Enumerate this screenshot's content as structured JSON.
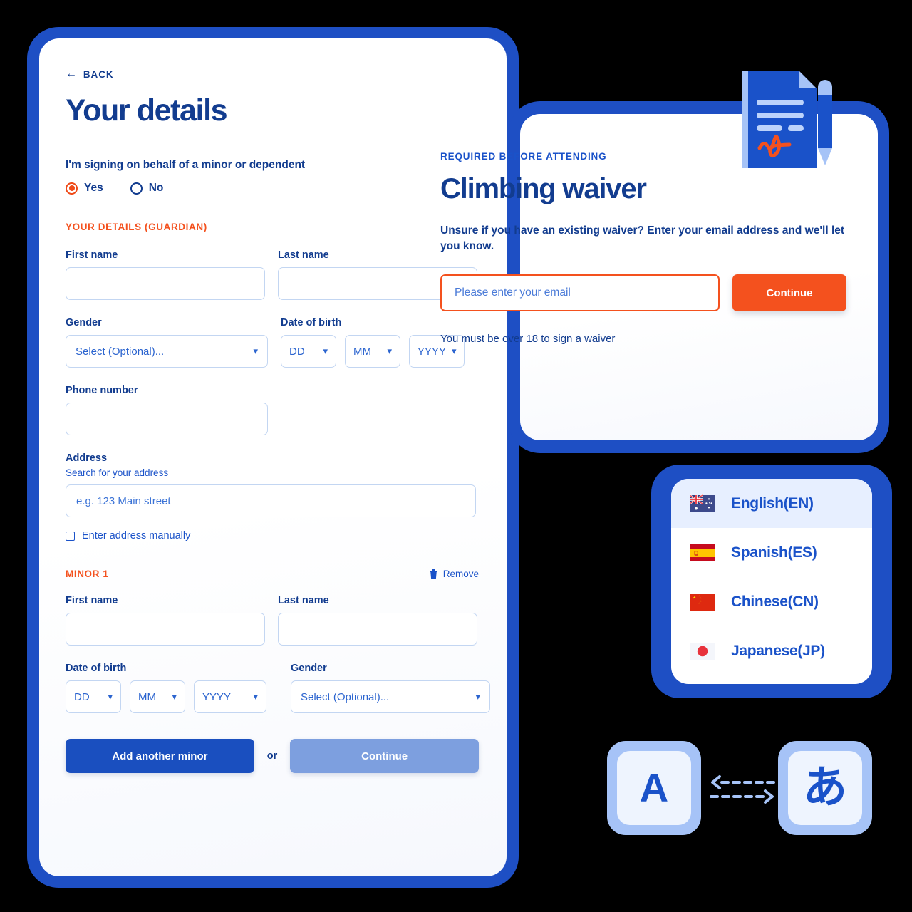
{
  "colors": {
    "brand_blue": "#1e4fc4",
    "deep_blue": "#123c8f",
    "link_blue": "#1a52c9",
    "accent_orange": "#f4511e",
    "muted_blue_button": "#7d9fdf",
    "input_border": "#c3d6f2"
  },
  "details_form": {
    "back_label": "BACK",
    "back_icon": "arrow-left-icon",
    "title": "Your details",
    "minor_question": "I'm signing on behalf of a minor or dependent",
    "radio_options": [
      {
        "label": "Yes",
        "selected": true
      },
      {
        "label": "No",
        "selected": false
      }
    ],
    "guardian_section_label": "YOUR DETAILS (GUARDIAN)",
    "guardian": {
      "first_name_label": "First name",
      "first_name_value": "",
      "last_name_label": "Last name",
      "last_name_value": "",
      "gender_label": "Gender",
      "gender_value": "Select (Optional)...",
      "dob_label": "Date of birth",
      "dob_day": "DD",
      "dob_month": "MM",
      "dob_year": "YYYY",
      "phone_label": "Phone number",
      "phone_value": "",
      "address_label": "Address",
      "address_sub_label": "Search for your address",
      "address_placeholder": "e.g. 123 Main street",
      "manual_address_label": "Enter address manually",
      "manual_address_checked": false
    },
    "minor_section_label": "MINOR 1",
    "remove_label": "Remove",
    "remove_icon": "trash-icon",
    "minor": {
      "first_name_label": "First name",
      "first_name_value": "",
      "last_name_label": "Last name",
      "last_name_value": "",
      "dob_label": "Date of birth",
      "dob_day": "DD",
      "dob_month": "MM",
      "dob_year": "YYYY",
      "gender_label": "Gender",
      "gender_value": "Select (Optional)..."
    },
    "add_minor_button": "Add another minor",
    "or_text": "or",
    "continue_button": "Continue"
  },
  "waiver_card": {
    "eyebrow": "REQUIRED BEFORE ATTENDING",
    "title": "Climbing waiver",
    "description": "Unsure if you have an existing waiver? Enter your email address and we'll let you know.",
    "email_placeholder": "Please enter your email",
    "email_value": "",
    "continue_button": "Continue",
    "note": "You must be over 18 to sign a waiver",
    "illustration_icon": "signed-document-and-pen-icon"
  },
  "language_selector": {
    "items": [
      {
        "label": "English(EN)",
        "flag": "flag-australia-icon",
        "active": true
      },
      {
        "label": "Spanish(ES)",
        "flag": "flag-spain-icon",
        "active": false
      },
      {
        "label": "Chinese(CN)",
        "flag": "flag-china-icon",
        "active": false
      },
      {
        "label": "Japanese(JP)",
        "flag": "flag-japan-icon",
        "active": false
      }
    ]
  },
  "translate_illustration": {
    "left_glyph": "A",
    "right_glyph": "あ",
    "arrows_icon": "bidirectional-dashed-arrows-icon"
  }
}
